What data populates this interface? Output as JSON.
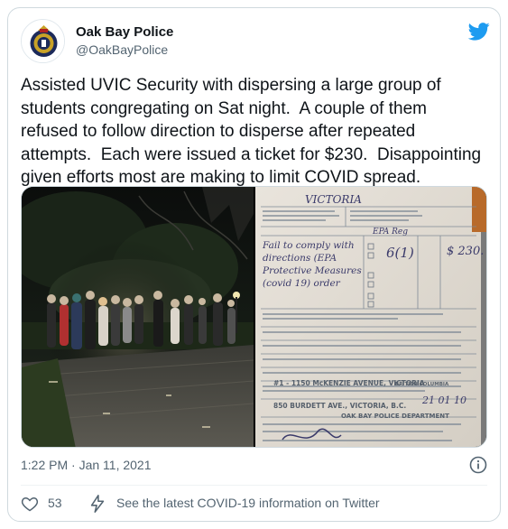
{
  "author": {
    "display_name": "Oak Bay Police",
    "handle": "@OakBayPolice"
  },
  "tweet": {
    "text": "Assisted UVIC Security with dispersing a large group of\nstudents congregating on Sat night.  A couple of them\nrefused to follow direction to disperse after repeated\nattempts.  Each were issued a ticket for $230.  Disappointing\ngiven efforts most are making to limit COVID spread.",
    "timestamp": "1:22 PM · Jan 11, 2021"
  },
  "media": {
    "photo_left": "night-crowd-photo",
    "photo_right": "violation-ticket-photo",
    "ticket_text": {
      "city": "VICTORIA",
      "act": "EPA Reg",
      "offence": "Fail to comply with directions (EPA Protective Measures (Covid 19) order",
      "section": "6(1)",
      "fine": "$ 230.",
      "address1": "#1 - 1150 McKENZIE AVENUE, VICTORIA",
      "address2": "850 BURDETT AVE., VICTORIA, B.C.",
      "dept": "OAK BAY POLICE DEPARTMENT",
      "date": "21 01 10",
      "province": "BRITISH COLUMBIA"
    }
  },
  "engagement": {
    "likes": "53",
    "covid_link_text": "See the latest COVID-19 information on Twitter"
  },
  "icons": {
    "bird": "twitter-bird-icon",
    "info": "info-icon",
    "heart": "heart-icon",
    "bolt": "lightning-icon"
  },
  "colors": {
    "twitter_blue": "#1d9bf0",
    "text_secondary": "#536471",
    "border": "#cfd9de"
  }
}
